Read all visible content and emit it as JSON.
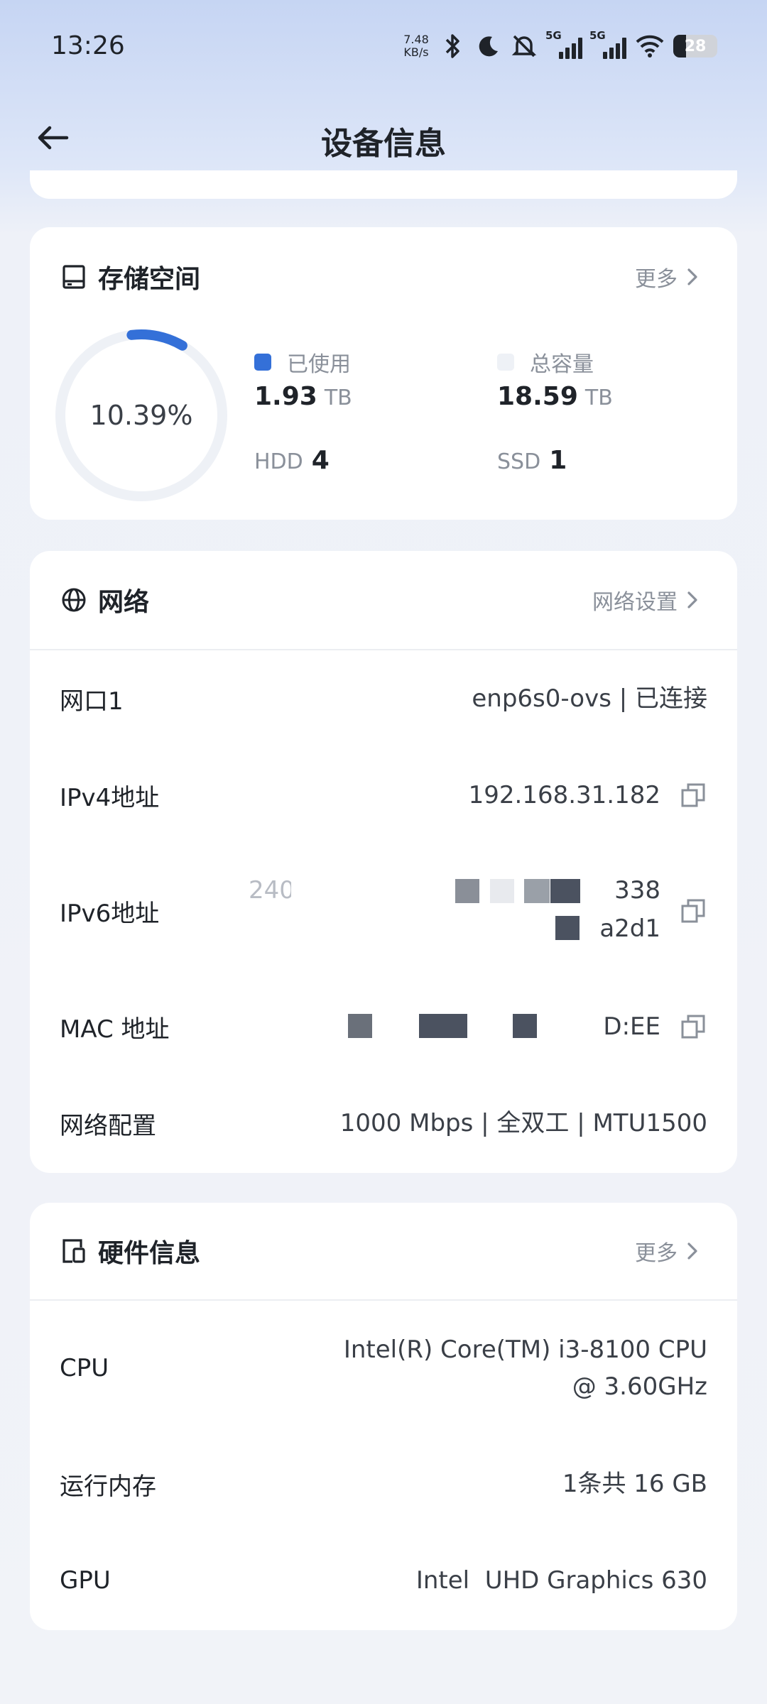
{
  "status_bar": {
    "time": "13:26",
    "net_speed_value": "7.48",
    "net_speed_unit": "KB/s",
    "network_tags": [
      "5G",
      "5G"
    ],
    "battery": "28"
  },
  "header": {
    "title": "设备信息"
  },
  "storage": {
    "title": "存储空间",
    "more_label": "更多",
    "percent": "10.39%",
    "used_fraction": 0.1039,
    "used_label": "已使用",
    "used_value": "1.93",
    "used_unit": "TB",
    "total_label": "总容量",
    "total_value": "18.59",
    "total_unit": "TB",
    "hdd_label": "HDD",
    "hdd_count": "4",
    "ssd_label": "SSD",
    "ssd_count": "1",
    "colors": {
      "used": "#3470d8",
      "total": "#eef1f6"
    }
  },
  "network": {
    "title": "网络",
    "settings_label": "网络设置",
    "rows": [
      {
        "label": "网口1",
        "value": "enp6s0-ovs | 已连接"
      },
      {
        "label": "IPv4地址",
        "value": "192.168.31.182"
      },
      {
        "label": "IPv6地址",
        "value_line1": "240",
        "value_line1_end": "338",
        "value_line2": "a2d1"
      },
      {
        "label": "MAC 地址",
        "value": "D:EE"
      },
      {
        "label": "网络配置",
        "value": "1000 Mbps | 全双工 | MTU1500"
      }
    ]
  },
  "hardware": {
    "title": "硬件信息",
    "more_label": "更多",
    "rows": [
      {
        "label": "CPU",
        "value_line1": "Intel(R) Core(TM) i3-8100 CPU",
        "value_line2": "@ 3.60GHz"
      },
      {
        "label": "运行内存",
        "value": "1条共 16 GB"
      },
      {
        "label": "GPU",
        "value": "Intel  UHD Graphics 630"
      }
    ]
  }
}
